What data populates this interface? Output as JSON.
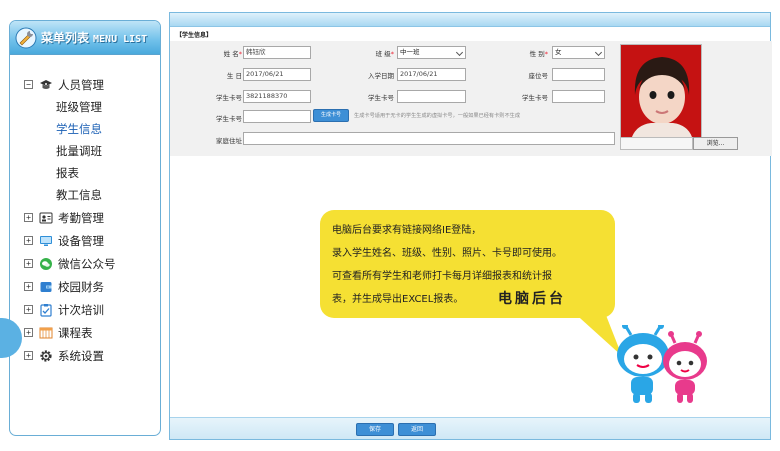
{
  "sidebar": {
    "title": "菜单列表",
    "title_en": "MENU LIST",
    "items": [
      {
        "label": "人员管理",
        "icon": "graduation-cap-icon",
        "expanded": true,
        "children": [
          "班级管理",
          "学生信息",
          "批量调班",
          "报表",
          "教工信息"
        ]
      },
      {
        "label": "考勤管理",
        "icon": "id-card-icon"
      },
      {
        "label": "设备管理",
        "icon": "monitor-icon"
      },
      {
        "label": "微信公众号",
        "icon": "wechat-icon"
      },
      {
        "label": "校园财务",
        "icon": "wallet-icon"
      },
      {
        "label": "计次培训",
        "icon": "clipboard-icon"
      },
      {
        "label": "课程表",
        "icon": "calendar-grid-icon"
      },
      {
        "label": "系统设置",
        "icon": "gear-icon"
      }
    ],
    "active_child": "学生信息"
  },
  "form": {
    "section_title": "【学生信息】",
    "name_label": "姓 名",
    "name_value": "韩钰欣",
    "class_label": "班 级",
    "class_value": "中一班",
    "gender_label": "性 别",
    "gender_value": "女",
    "birthday_label": "生 日",
    "birthday_value": "2017/06/21",
    "enroll_label": "入学日期",
    "enroll_value": "2017/06/21",
    "seat_label": "座位号",
    "seat_value": "",
    "card1_label": "学生卡号",
    "card1_value": "3821188370",
    "card2_label": "学生卡号",
    "card2_value": "",
    "card3_label": "学生卡号",
    "card3_value": "",
    "card4_label": "学生卡号",
    "card4_value": "",
    "gen_button": "生成卡号",
    "gen_hint": "生成卡号适用于无卡的学生生成的虚拟卡号，一般如果已经有卡则不生成",
    "address_label": "家庭住址",
    "address_value": "",
    "browse_button": "浏览...",
    "required_mark": "*"
  },
  "actions": {
    "save": "保存",
    "back": "返回"
  },
  "callout": {
    "line1": "电脑后台要求有链接网络IE登陆，",
    "line2": "录入学生姓名、班级、性别、照片、卡号即可使用。",
    "line3": "可查看所有学生和老师打卡每月详细报表和统计报",
    "line4": "表，并生成导出EXCEL报表。",
    "brand": "电脑后台"
  },
  "colors": {
    "accent": "#3d8fd6",
    "sidebar_header": "#6fc0ea",
    "bubble": "#f5e033",
    "photo_bg": "#c21010",
    "required": "#ee2233"
  }
}
